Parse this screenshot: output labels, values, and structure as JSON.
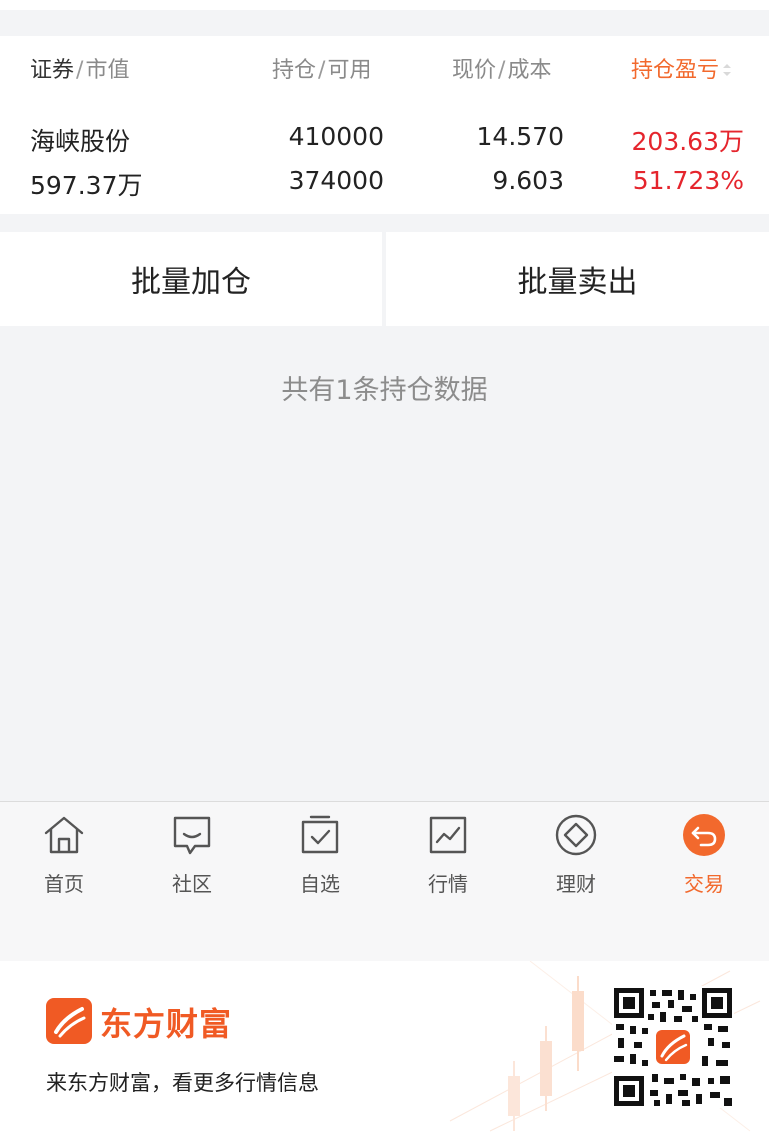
{
  "header": {
    "col1_main": "证券",
    "col1_sub": "市值",
    "col2_main": "持仓",
    "col2_sub": "可用",
    "col3_main": "现价",
    "col3_sub": "成本",
    "col4": "持仓盈亏",
    "sep": "/"
  },
  "position": {
    "name": "海峡股份",
    "market_value": "597.37万",
    "holding": "410000",
    "available": "374000",
    "price": "14.570",
    "cost": "9.603",
    "pnl": "203.63万",
    "pnl_pct": "51.723%"
  },
  "actions": {
    "batch_add": "批量加仓",
    "batch_sell": "批量卖出"
  },
  "summary": "共有1条持仓数据",
  "tabs": [
    {
      "label": "首页",
      "icon": "home-icon"
    },
    {
      "label": "社区",
      "icon": "community-icon"
    },
    {
      "label": "自选",
      "icon": "watchlist-icon"
    },
    {
      "label": "行情",
      "icon": "market-chart-icon"
    },
    {
      "label": "理财",
      "icon": "wealth-icon"
    },
    {
      "label": "交易",
      "icon": "trade-icon"
    }
  ],
  "active_tab": "交易",
  "banner": {
    "brand": "东方财富",
    "slogan": "来东方财富，看更多行情信息"
  },
  "colors": {
    "accent": "#f2692d",
    "gain": "#e5252d",
    "brand": "#f05a24"
  }
}
